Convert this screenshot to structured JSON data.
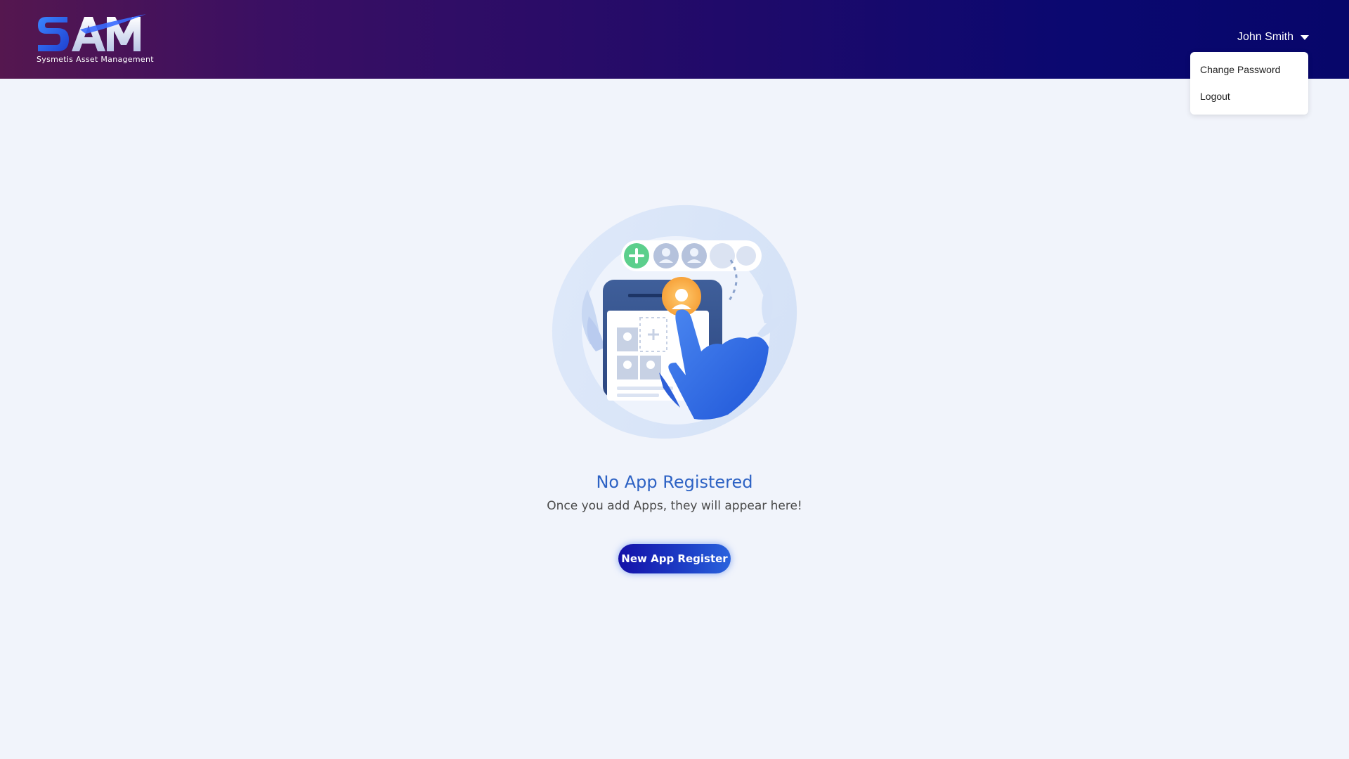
{
  "header": {
    "logo_text": "SAM",
    "logo_subtitle": "Sysmetis Asset Management",
    "user_name": "John Smith"
  },
  "user_dropdown": {
    "items": [
      {
        "label": "Change Password"
      },
      {
        "label": "Logout"
      }
    ]
  },
  "empty_state": {
    "title": "No App Registered",
    "subtitle": "Once you add Apps, they will appear here!",
    "button_label": "New App Register"
  },
  "colors": {
    "header_gradient_start": "#55174f",
    "header_gradient_end": "#07066a",
    "page_background": "#f1f4fb",
    "title_color": "#2d62c4",
    "button_color": "#1410a8"
  },
  "icons": {
    "dropdown_caret": "caret-down-icon",
    "illustration": "add-user-illustration"
  }
}
